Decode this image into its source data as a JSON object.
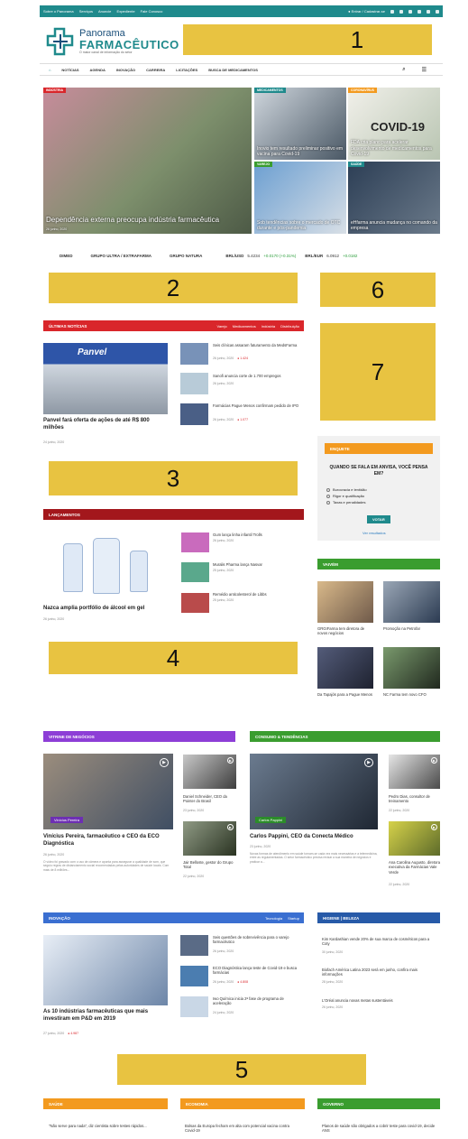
{
  "topbar": {
    "links": [
      "Sobre o Panorama",
      "Serviços",
      "Anuncie",
      "Expediente",
      "Fale Conosco"
    ],
    "login": "Entrar / Cadastrar-se"
  },
  "logo": {
    "line1": "Panorama",
    "line2": "FARMACÊUTICO",
    "tagline": "O maior canal de informação do setor"
  },
  "ads": {
    "a1": "1",
    "a2": "2",
    "a3": "3",
    "a4": "4",
    "a5": "5",
    "a6": "6",
    "a7": "7"
  },
  "nav": {
    "items": [
      "NOTÍCIAS",
      "AGENDA",
      "INOVAÇÃO",
      "CARREIRA",
      "LICITAÇÕES",
      "BUSCA DE MEDICAMENTOS"
    ]
  },
  "hero": {
    "main": {
      "tag": "INDÚSTRIA",
      "title": "Dependência externa preocupa indústria farmacêutica",
      "date": "26 junho, 2020"
    },
    "s1": {
      "tag": "MEDICAMENTOS",
      "title": "Inovio tem resultado preliminar positivo em vacina para Covid-19"
    },
    "s2": {
      "tag": "CORONAVÍRUS",
      "title": "FDA cria plano para acelerar desenvolvimento de medicamentos para Covid-19",
      "imgtext": "COVID-19"
    },
    "s3": {
      "tag": "VAREJO",
      "title": "Sob tendências sobre o mercado de OTC durante e pós-pandemia"
    },
    "s4": {
      "tag": "SAÚDE",
      "title": "eHfarma anuncia mudança no comando da empresa"
    }
  },
  "ticker": {
    "items": [
      "DIMED",
      "GRUPO ULTRA / EXTRAFARMA",
      "GRUPO NATURA"
    ],
    "fx1_label": "BRL/USD",
    "fx1_value": "5.4234",
    "fx1_change": "+0.0170 (+0.31%)",
    "fx2_label": "BRL/EUR",
    "fx2_value": "6.0912",
    "fx2_change": "+0.0182"
  },
  "ultimas": {
    "title": "ÚLTIMAS NOTÍCIAS",
    "cats": [
      "Varejo",
      "Medicamentos",
      "Indústria",
      "Distribuição"
    ],
    "main_title": "Panvel fará oferta de ações de até R$ 800 milhões",
    "main_date": "24 junho, 2020",
    "main_img": "Panvel",
    "items": [
      {
        "title": "Seis clínicas assaram faturamento da MedsFarma",
        "date": "26 junho, 2020",
        "hot": "1.424"
      },
      {
        "title": "Sanofi anuncia corte de 1.700 empregos",
        "date": "26 junho, 2020",
        "hot": ""
      },
      {
        "title": "Farmácias Pague Menos confirmam pedido de IPO",
        "date": "26 junho, 2020",
        "hot": "1.077"
      }
    ]
  },
  "enquete": {
    "title": "ENQUETE",
    "question": "QUANDO SE FALA EM ANVISA, VOCÊ PENSA EM?",
    "options": [
      "Burocracia e lentidão",
      "Rigor e qualificação",
      "Taxas e penalidades"
    ],
    "vote": "VOTAR",
    "results": "Ver resultados"
  },
  "lancamentos": {
    "title": "LANÇAMENTOS",
    "main_title": "Nazca amplia portfólio de álcool em gel",
    "main_date": "26 junho, 2020",
    "items": [
      {
        "title": "Gum lança linha infantil Trolls",
        "date": "26 junho, 2020"
      },
      {
        "title": "Muralis Pharma lança Nasvar",
        "date": "25 junho, 2020"
      },
      {
        "title": "Remédio anticolesterol de Libbs",
        "date": "25 junho, 2020"
      }
    ]
  },
  "vaivem": {
    "title": "VAIVÉM",
    "items": [
      {
        "title": "GRGIFarma tem diretora de novos negócios"
      },
      {
        "title": "Promoção na Petrofar"
      },
      {
        "title": "Da Tapajós para a Pague Menos"
      },
      {
        "title": "NC Farma tem novo CFO"
      }
    ]
  },
  "vitrine": {
    "title": "VITRINE DE NEGÓCIOS",
    "overlay_name": "Vinícius Pereira",
    "main_title": "Vinícius Pereira, farmacêutico e CEO da ECO Diagnóstica",
    "main_date": "26 junho, 2020",
    "main_desc": "O vídeo foi gravado com o uso de câmera e aponta para assegurar a qualidade de som, que seguiu regras de distanciamento social recomendadas pelas autoridades de saúde locais. Com mais de 8 milhões...",
    "items": [
      {
        "title": "Daniel Schneider, CEO da Pointer do Brasil",
        "date": "23 junho, 2020"
      },
      {
        "title": "Jair Belloste, gestor do Grupo Total",
        "date": "22 junho, 2020"
      }
    ]
  },
  "consumo": {
    "title": "CONSUMO & TENDÊNCIAS",
    "overlay_name": "Carlos Pappini",
    "main_title": "Carlos Pappini, CEO da Conecta Médico",
    "main_date": "23 junho, 2020",
    "main_desc": "Novas formas de atendimento em saúde tornam-se cada vez mais necessárias e a telemedicina, entre as regulamentadas. O setor farmacêutico precisa revisar a sua maneira de negócios e praticar a...",
    "items": [
      {
        "title": "Pedro Dias, consultor de treinamento",
        "date": "22 junho, 2020"
      },
      {
        "title": "Ana Carolina Augusto, diretora executiva da Farmácias Vale Verde",
        "date": "22 junho, 2020"
      }
    ]
  },
  "inovacao": {
    "title": "INOVAÇÃO",
    "cats": [
      "Tecnologia",
      "Startup"
    ],
    "main_title": "As 10 indústrias farmacêuticas que mais investiram em P&D em 2019",
    "main_date": "27 junho, 2020",
    "main_hot": "4.987",
    "items": [
      {
        "title": "Seis questões de sobrevivência para o varejo farmacêutico",
        "date": "26 junho, 2020",
        "hot": ""
      },
      {
        "title": "ECO Diagnóstica lança teste de Covid-19 e busca farmácias",
        "date": "26 junho, 2020",
        "hot": "4.808"
      },
      {
        "title": "Iwo Química inicia 2ª fase de programa de aceleração",
        "date": "24 junho, 2020",
        "hot": ""
      }
    ]
  },
  "higiene": {
    "title": "HIGIENE | BELEZA",
    "items": [
      {
        "title": "Kim Kardashian vende 20% de sua marca de cosméticos para a Coty",
        "date": "30 junho, 2020"
      },
      {
        "title": "Biofach América Latina 2023 será em junho, confira mais informações",
        "date": "28 junho, 2020"
      },
      {
        "title": "L'Oréal anuncia novas metas sustentáveis",
        "date": "26 junho, 2020"
      }
    ]
  },
  "bottom": {
    "saude": {
      "title": "SAÚDE",
      "item": "\"Não serve para nada\", diz cientista sobre testes rápidos..."
    },
    "economia": {
      "title": "ECONOMIA",
      "item": "Bolsas da Europa fecham em alta com potencial vacina contra Covid-19"
    },
    "governo": {
      "title": "GOVERNO",
      "item": "Planos de saúde são obrigados a cobrir teste para covid-19, decide ANS"
    }
  },
  "colors": {
    "teal": "#1f8a8c",
    "red": "#d9262b",
    "darkred": "#a3171c",
    "green": "#3a9d2f",
    "purple": "#8d3ed6",
    "blue": "#3a6fd1",
    "darkblue": "#275aa8",
    "orange": "#f39a1f",
    "ad": "#e8c341"
  }
}
